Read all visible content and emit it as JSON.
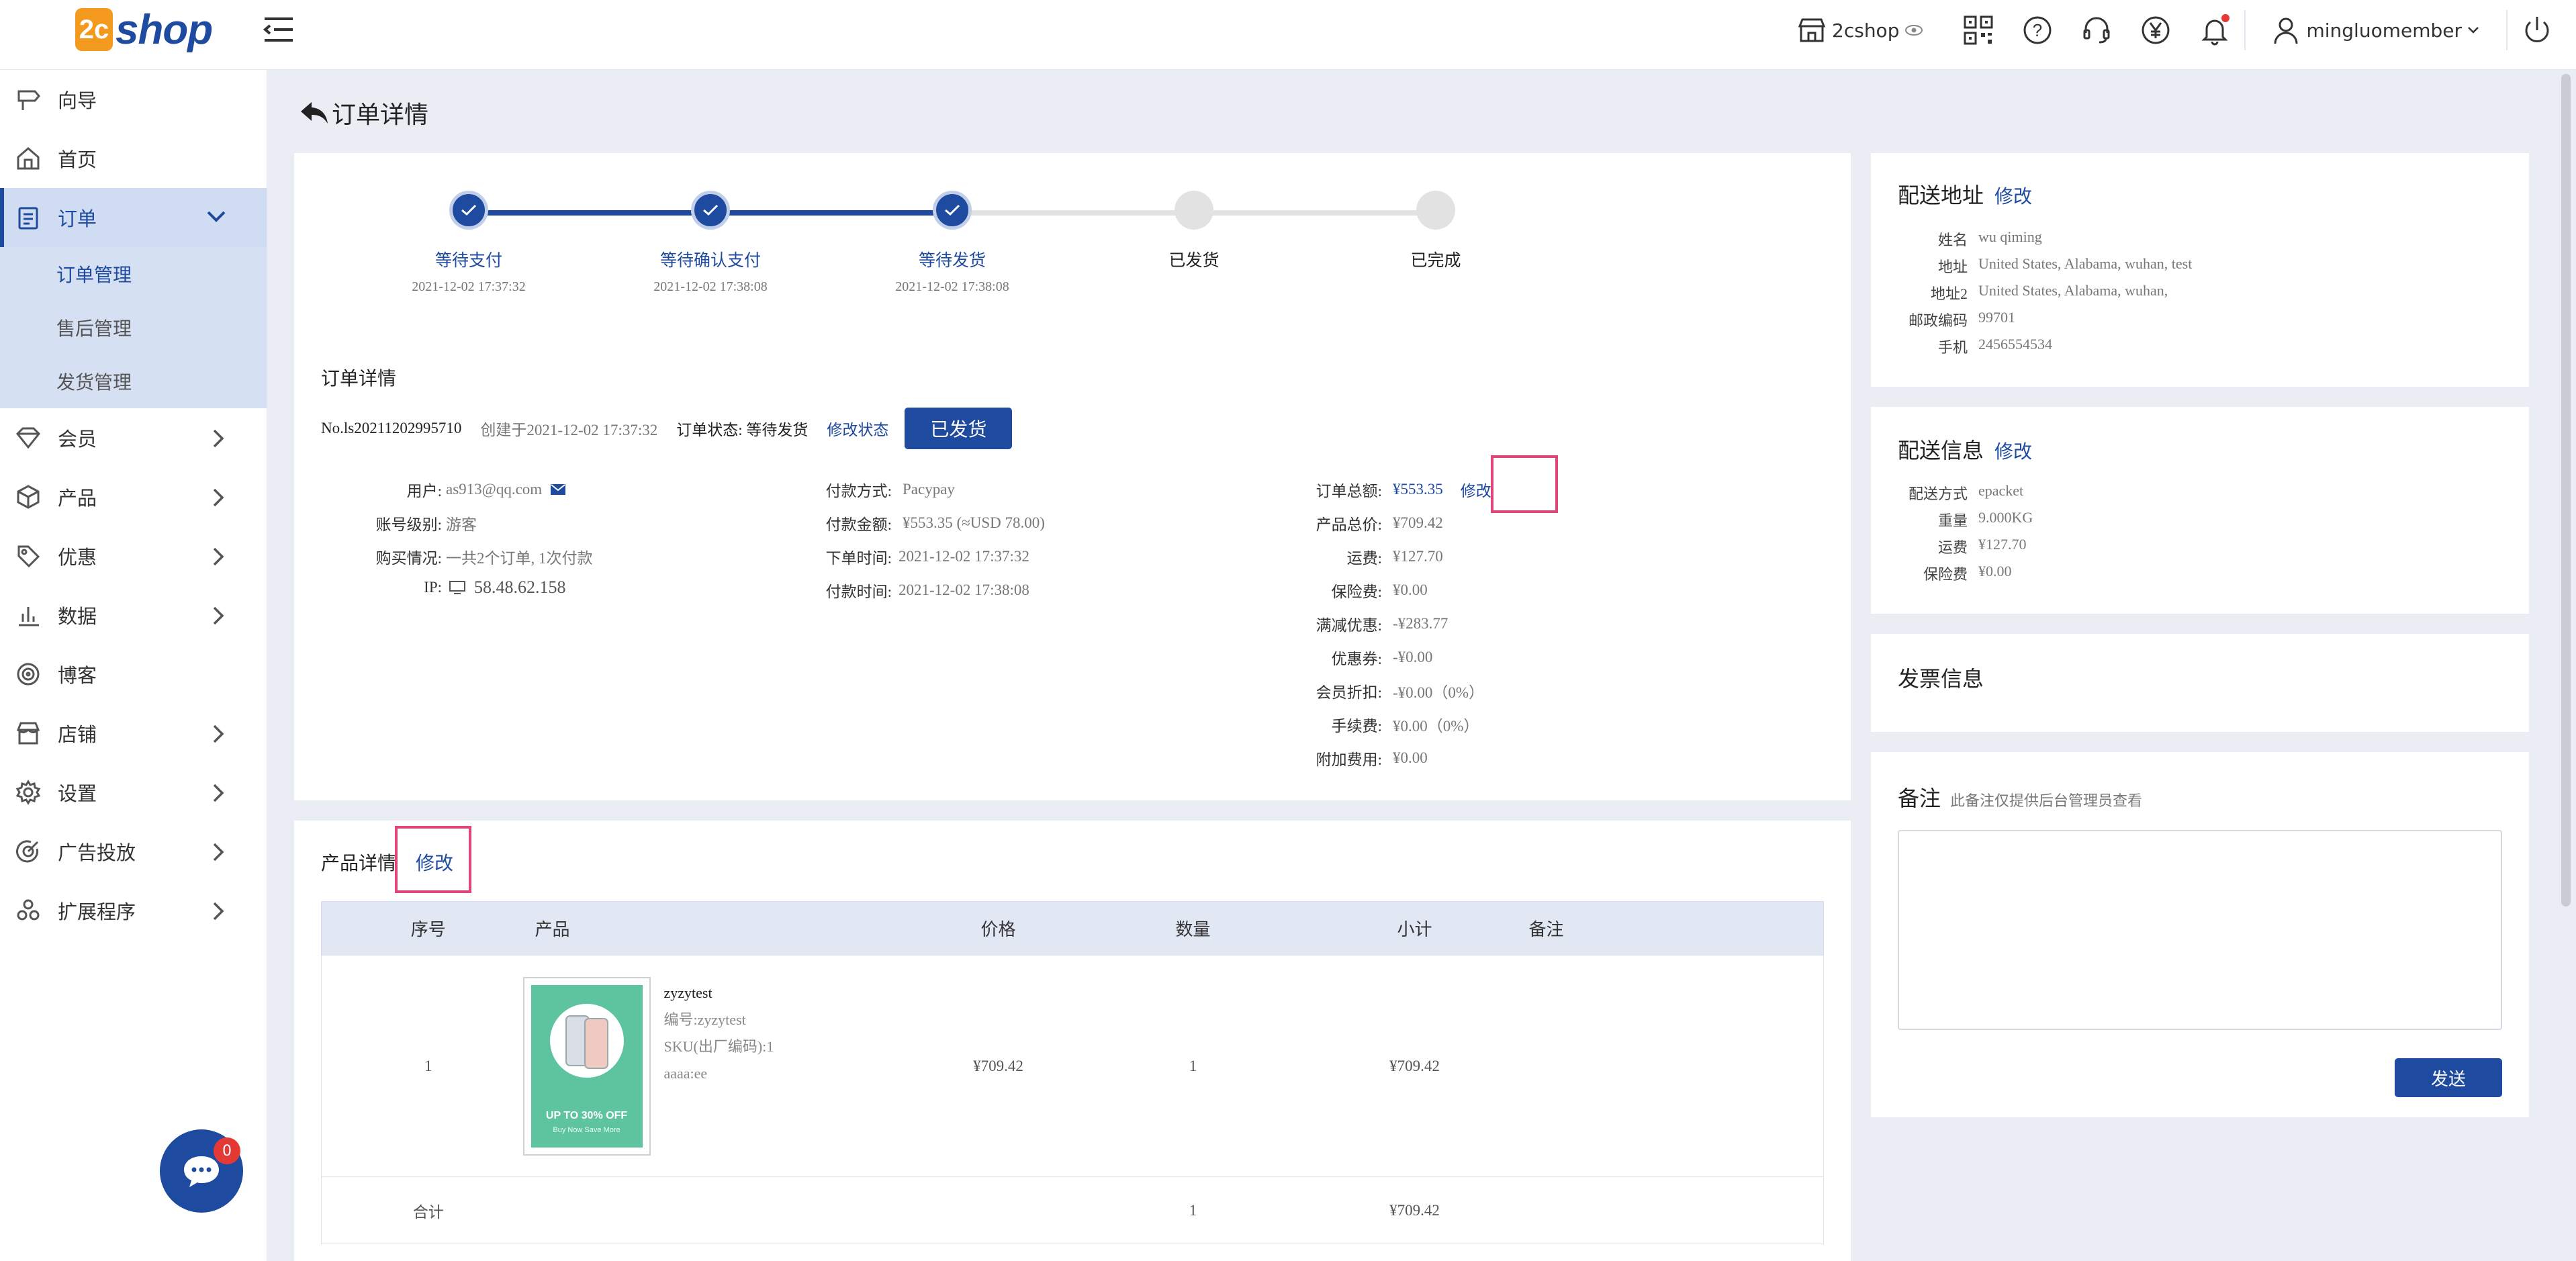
{
  "header": {
    "logo_mark": "2c",
    "logo_word": "shop",
    "shop_name": "2cshop",
    "user_name": "mingluomember",
    "icons": [
      "store-icon",
      "eye-icon",
      "qrcode-icon",
      "help-icon",
      "headset-icon",
      "yen-icon",
      "bell-icon",
      "user-icon",
      "power-icon"
    ]
  },
  "sidebar": {
    "items": [
      {
        "label": "向导",
        "icon": "signpost-icon"
      },
      {
        "label": "首页",
        "icon": "home-icon"
      },
      {
        "label": "订单",
        "icon": "clipboard-icon"
      },
      {
        "label": "会员",
        "icon": "gem-icon"
      },
      {
        "label": "产品",
        "icon": "box-icon"
      },
      {
        "label": "优惠",
        "icon": "tag-icon"
      },
      {
        "label": "数据",
        "icon": "chart-icon"
      },
      {
        "label": "博客",
        "icon": "target-icon"
      },
      {
        "label": "店铺",
        "icon": "shop-icon"
      },
      {
        "label": "设置",
        "icon": "gear-icon"
      },
      {
        "label": "广告投放",
        "icon": "ad-icon"
      },
      {
        "label": "扩展程序",
        "icon": "apps-icon"
      }
    ],
    "sub_items": [
      "订单管理",
      "售后管理",
      "发货管理"
    ],
    "chat_badge": "0"
  },
  "page": {
    "title": "订单详情"
  },
  "steps": [
    {
      "label": "等待支付",
      "time": "2021-12-02 17:37:32"
    },
    {
      "label": "等待确认支付",
      "time": "2021-12-02 17:38:08"
    },
    {
      "label": "等待发货",
      "time": "2021-12-02 17:38:08"
    },
    {
      "label": "已发货",
      "time": ""
    },
    {
      "label": "已完成",
      "time": ""
    }
  ],
  "order": {
    "section_title": "订单详情",
    "number": "No.ls20211202995710",
    "created": "创建于2021-12-02 17:37:32",
    "status_label": "订单状态: 等待发货",
    "modify_status": "修改状态",
    "shipped_button": "已发货",
    "left": [
      {
        "k": "用户:",
        "v": "as913@qq.com"
      },
      {
        "k": "账号级别:",
        "v": "游客"
      },
      {
        "k": "购买情况:",
        "v": "一共2个订单, 1次付款"
      },
      {
        "k": "IP:",
        "v": "58.48.62.158"
      }
    ],
    "mid": [
      {
        "k": "付款方式:",
        "v": "Pacypay"
      },
      {
        "k": "付款金额:",
        "v": "¥553.35 (≈USD 78.00)"
      },
      {
        "k": "下单时间:",
        "v": "2021-12-02 17:37:32"
      },
      {
        "k": "付款时间:",
        "v": "2021-12-02 17:38:08"
      }
    ],
    "right": [
      {
        "k": "订单总额:",
        "v": "¥553.35"
      },
      {
        "k": "产品总价:",
        "v": "¥709.42"
      },
      {
        "k": "运费:",
        "v": "¥127.70"
      },
      {
        "k": "保险费:",
        "v": "¥0.00"
      },
      {
        "k": "满减优惠:",
        "v": "-¥283.77"
      },
      {
        "k": "优惠券:",
        "v": "-¥0.00"
      },
      {
        "k": "会员折扣:",
        "v": "-¥0.00（0%）"
      },
      {
        "k": "手续费:",
        "v": "¥0.00（0%）"
      },
      {
        "k": "附加费用:",
        "v": "¥0.00"
      }
    ],
    "edit_total": "修改"
  },
  "products": {
    "title": "产品详情",
    "edit": "修改",
    "columns": [
      "序号",
      "产品",
      "价格",
      "数量",
      "小计",
      "备注"
    ],
    "rows": [
      {
        "index": "1",
        "name": "zyzytest",
        "code": "编号:zyzytest",
        "sku": "SKU(出厂编码):1",
        "attr": "aaaa:ee",
        "price": "¥709.42",
        "qty": "1",
        "subtotal": "¥709.42",
        "note": "",
        "thumb_text": "UP TO 30% OFF",
        "thumb_sub": "Buy Now Save More"
      }
    ],
    "total": {
      "label": "合计",
      "qty": "1",
      "subtotal": "¥709.42"
    }
  },
  "shipping_address": {
    "title": "配送地址",
    "edit": "修改",
    "rows": [
      {
        "k": "姓名",
        "v": "wu qiming"
      },
      {
        "k": "地址",
        "v": "United States, Alabama, wuhan, test"
      },
      {
        "k": "地址2",
        "v": "United States, Alabama, wuhan,"
      },
      {
        "k": "邮政编码",
        "v": "99701"
      },
      {
        "k": "手机",
        "v": "2456554534"
      }
    ]
  },
  "shipping_info": {
    "title": "配送信息",
    "edit": "修改",
    "rows": [
      {
        "k": "配送方式",
        "v": "epacket"
      },
      {
        "k": "重量",
        "v": "9.000KG"
      },
      {
        "k": "运费",
        "v": "¥127.70"
      },
      {
        "k": "保险费",
        "v": "¥0.00"
      }
    ]
  },
  "invoice": {
    "title": "发票信息"
  },
  "remarks": {
    "title": "备注",
    "hint": "此备注仅提供后台管理员查看",
    "send": "发送"
  },
  "colors": {
    "accent": "#1e4aa0",
    "highlight": "#e0457b",
    "step_todo": "#e2e2e2"
  }
}
